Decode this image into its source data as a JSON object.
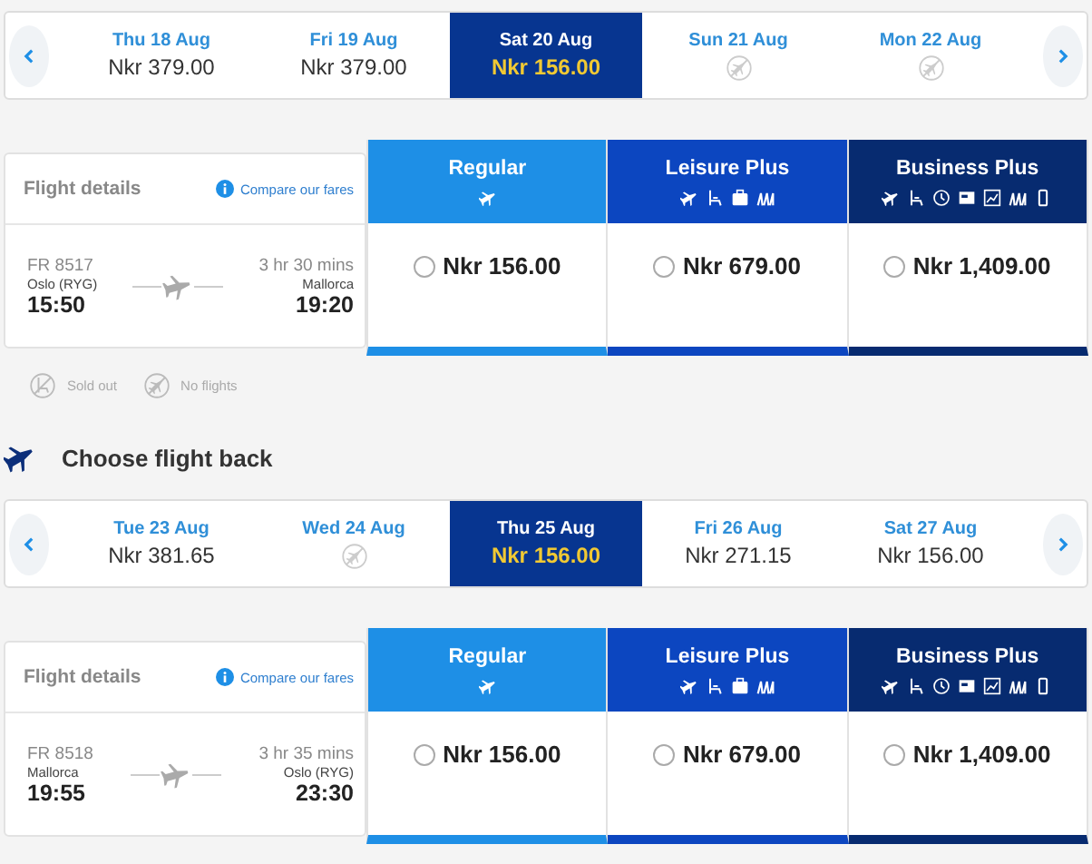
{
  "outbound": {
    "dates": [
      {
        "day": "Thu 18 Aug",
        "price": "Nkr 379.00",
        "selected": false
      },
      {
        "day": "Fri 19 Aug",
        "price": "Nkr 379.00",
        "selected": false
      },
      {
        "day": "Sat 20 Aug",
        "price": "Nkr 156.00",
        "selected": true
      },
      {
        "day": "Sun 21 Aug",
        "selected": false
      },
      {
        "day": "Mon 22 Aug",
        "selected": false
      }
    ],
    "details_label": "Flight details",
    "compare_link": "Compare our fares",
    "flight": {
      "number": "FR 8517",
      "origin": "Oslo (RYG)",
      "depart": "15:50",
      "duration": "3 hr 30 mins",
      "destination": "Mallorca",
      "arrive": "19:20"
    },
    "fares": [
      {
        "name": "Regular",
        "kind": "regular",
        "price": "Nkr 156.00",
        "selected": false
      },
      {
        "name": "Leisure Plus",
        "kind": "leisure",
        "price": "Nkr 679.00",
        "selected": false
      },
      {
        "name": "Business Plus",
        "kind": "business",
        "price": "Nkr 1,409.00",
        "selected": false
      }
    ]
  },
  "legend": [
    {
      "kind": "sold_out",
      "label": "Sold out"
    },
    {
      "kind": "no_flights",
      "label": "No flights"
    }
  ],
  "return_heading": "Choose flight back",
  "return": {
    "dates": [
      {
        "day": "Tue 23 Aug",
        "price": "Nkr 381.65",
        "selected": false
      },
      {
        "day": "Wed 24 Aug",
        "selected": false
      },
      {
        "day": "Thu 25 Aug",
        "price": "Nkr 156.00",
        "selected": true
      },
      {
        "day": "Fri 26 Aug",
        "price": "Nkr 271.15",
        "selected": false
      },
      {
        "day": "Sat 27 Aug",
        "price": "Nkr 156.00",
        "selected": false
      }
    ],
    "details_label": "Flight details",
    "compare_link": "Compare our fares",
    "flight": {
      "number": "FR 8518",
      "origin": "Mallorca",
      "depart": "19:55",
      "duration": "3 hr 35 mins",
      "destination": "Oslo (RYG)",
      "arrive": "23:30"
    },
    "fares": [
      {
        "name": "Regular",
        "kind": "regular",
        "price": "Nkr 156.00",
        "selected": false
      },
      {
        "name": "Leisure Plus",
        "kind": "leisure",
        "price": "Nkr 679.00",
        "selected": false
      },
      {
        "name": "Business Plus",
        "kind": "business",
        "price": "Nkr 1,409.00",
        "selected": false
      }
    ]
  }
}
